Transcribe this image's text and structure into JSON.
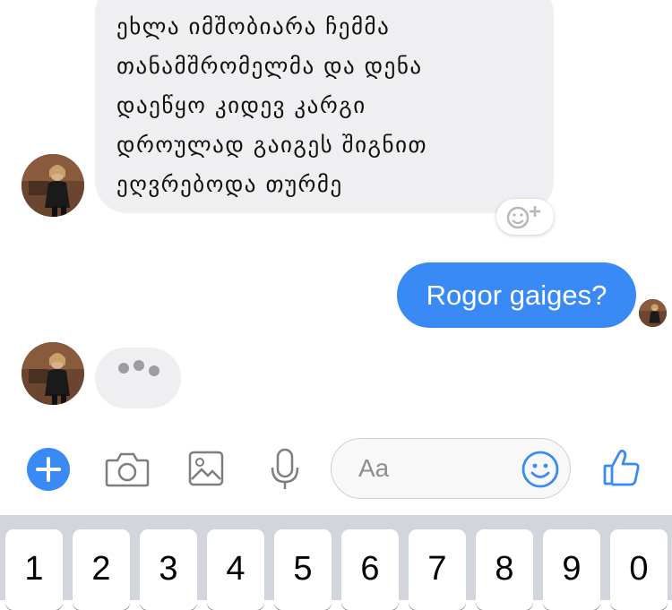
{
  "conversation": {
    "incoming_message": {
      "lines": [
        "ეხლა იმშობიარა ჩემმა",
        "თანამშრომელმა და დენა",
        "დაეწყო კიდევ კარგი",
        "დროულად გაიგეს შიგნით",
        "ეღვრებოდა  თურმე"
      ]
    },
    "outgoing_message": {
      "text": "Rogor gaiges?"
    }
  },
  "composer": {
    "placeholder": "Aa",
    "tools": [
      "plus-icon",
      "camera-icon",
      "image-icon",
      "microphone-icon",
      "emoji-icon",
      "thumbs-up-icon"
    ],
    "accent_color": "#3a8af6"
  },
  "keyboard": {
    "keys": [
      "1",
      "2",
      "3",
      "4",
      "5",
      "6",
      "7",
      "8",
      "9",
      "0"
    ]
  }
}
